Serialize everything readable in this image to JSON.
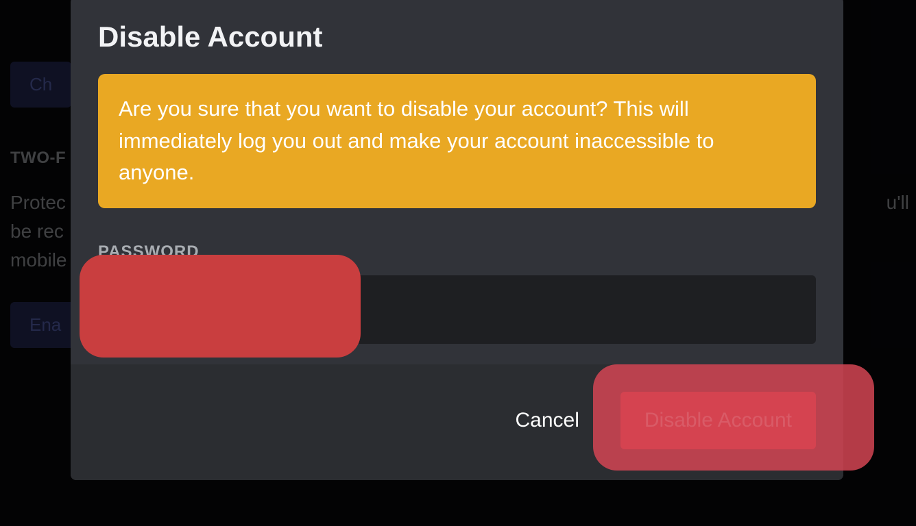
{
  "background": {
    "change_button": "Ch",
    "two_factor_label": "TWO-F",
    "security_text_1": "Protec",
    "security_text_2": "be rec",
    "security_text_3": "mobile",
    "enable_button": "Ena",
    "right_text": "u'll"
  },
  "modal": {
    "title": "Disable Account",
    "warning_text": "Are you sure that you want to disable your account? This will immediately log you out and make your account inaccessible to anyone.",
    "password_label": "PASSWORD",
    "password_value": "",
    "cancel_label": "Cancel",
    "disable_label": "Disable Account"
  }
}
